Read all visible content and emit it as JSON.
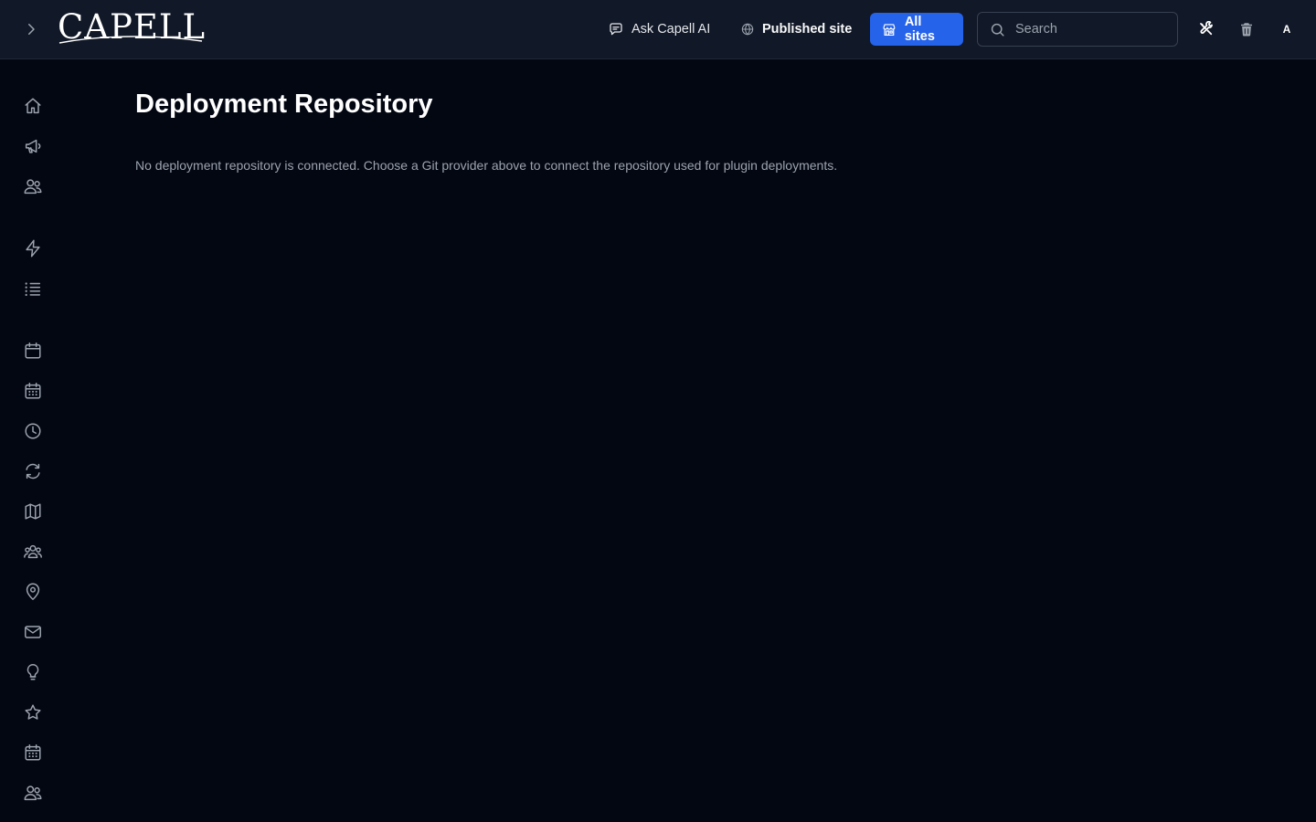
{
  "header": {
    "logo_text": "CAPELL",
    "ask_label": "Ask Capell AI",
    "published_label": "Published site",
    "all_sites_label": "All sites",
    "search_placeholder": "Search",
    "avatar_initial": "A"
  },
  "icons": {
    "expand": "chevron-right-icon",
    "ask": "chat-bubble-icon",
    "published": "globe-icon",
    "all_sites": "storefront-icon",
    "search": "search-icon",
    "tools": "wrench-screwdriver-icon",
    "trash": "trash-icon"
  },
  "sidebar": {
    "items": [
      {
        "icon": "home-icon"
      },
      {
        "icon": "megaphone-icon"
      },
      {
        "icon": "users-icon"
      },
      {
        "icon": "bolt-icon"
      },
      {
        "icon": "list-icon"
      },
      {
        "icon": "calendar-icon"
      },
      {
        "icon": "calendar-days-icon"
      },
      {
        "icon": "clock-icon"
      },
      {
        "icon": "refresh-icon"
      },
      {
        "icon": "map-icon"
      },
      {
        "icon": "user-group-icon"
      },
      {
        "icon": "map-pin-icon"
      },
      {
        "icon": "envelope-icon"
      },
      {
        "icon": "light-bulb-icon"
      },
      {
        "icon": "star-icon"
      },
      {
        "icon": "calendar-days-icon"
      },
      {
        "icon": "users-icon"
      }
    ]
  },
  "main": {
    "title": "Deployment Repository",
    "description": "No deployment repository is connected. Choose a Git provider above to connect the repository used for plugin deployments."
  },
  "colors": {
    "background": "#030712",
    "topbar": "#111827",
    "accent": "#2563eb",
    "muted_text": "#9ca3af"
  }
}
